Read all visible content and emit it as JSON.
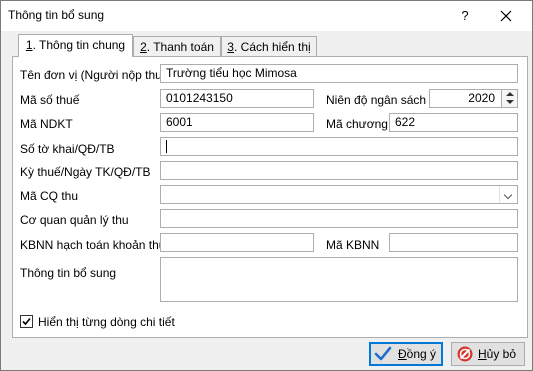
{
  "window": {
    "title": "Thông tin bổ sung",
    "help_label": "?",
    "close_label": "✕"
  },
  "tabs": [
    {
      "label": "1. Thông tin chung",
      "key": "1",
      "rest": ". Thông tin chung",
      "active": true
    },
    {
      "label": "2. Thanh toán",
      "key": "2",
      "rest": ". Thanh toán",
      "active": false
    },
    {
      "label": "3. Cách hiển thị",
      "key": "3",
      "rest": ". Cách hiển thị",
      "active": false
    }
  ],
  "form": {
    "ten_don_vi": {
      "label": "Tên đơn vị (Người nộp thuế)",
      "value": "Trường tiểu học Mimosa"
    },
    "ma_so_thue": {
      "label": "Mã số thuế",
      "value": "0101243150"
    },
    "nien_do": {
      "label": "Niên độ ngân sách",
      "value": "2020"
    },
    "ma_ndkt": {
      "label": "Mã NDKT",
      "value": "6001"
    },
    "ma_chuong": {
      "label": "Mã chương",
      "value": "622"
    },
    "so_to_khai": {
      "label": "Số tờ khai/QĐ/TB",
      "value": ""
    },
    "ky_thue": {
      "label": "Kỳ thuế/Ngày TK/QĐ/TB",
      "value": ""
    },
    "ma_cq_thu": {
      "label": "Mã CQ thu",
      "value": ""
    },
    "co_quan_quan_ly": {
      "label": "Cơ quan quản lý thu",
      "value": ""
    },
    "kbnn_hach_toan": {
      "label": "KBNN hạch toán khoản thu",
      "value": ""
    },
    "ma_kbnn": {
      "label": "Mã KBNN",
      "value": ""
    },
    "thong_tin_bo_sung": {
      "label": "Thông tin bổ sung",
      "value": ""
    }
  },
  "checkbox": {
    "label": "Hiển thị từng dòng chi tiết",
    "checked": true
  },
  "buttons": {
    "ok_key": "Đ",
    "ok_rest": "ồng ý",
    "cancel_key": "H",
    "cancel_rest": "ủy bỏ"
  },
  "colors": {
    "ok_icon": "#1f6fd1",
    "cancel_icon": "#d9342b",
    "focus_border": "#0078d7"
  }
}
